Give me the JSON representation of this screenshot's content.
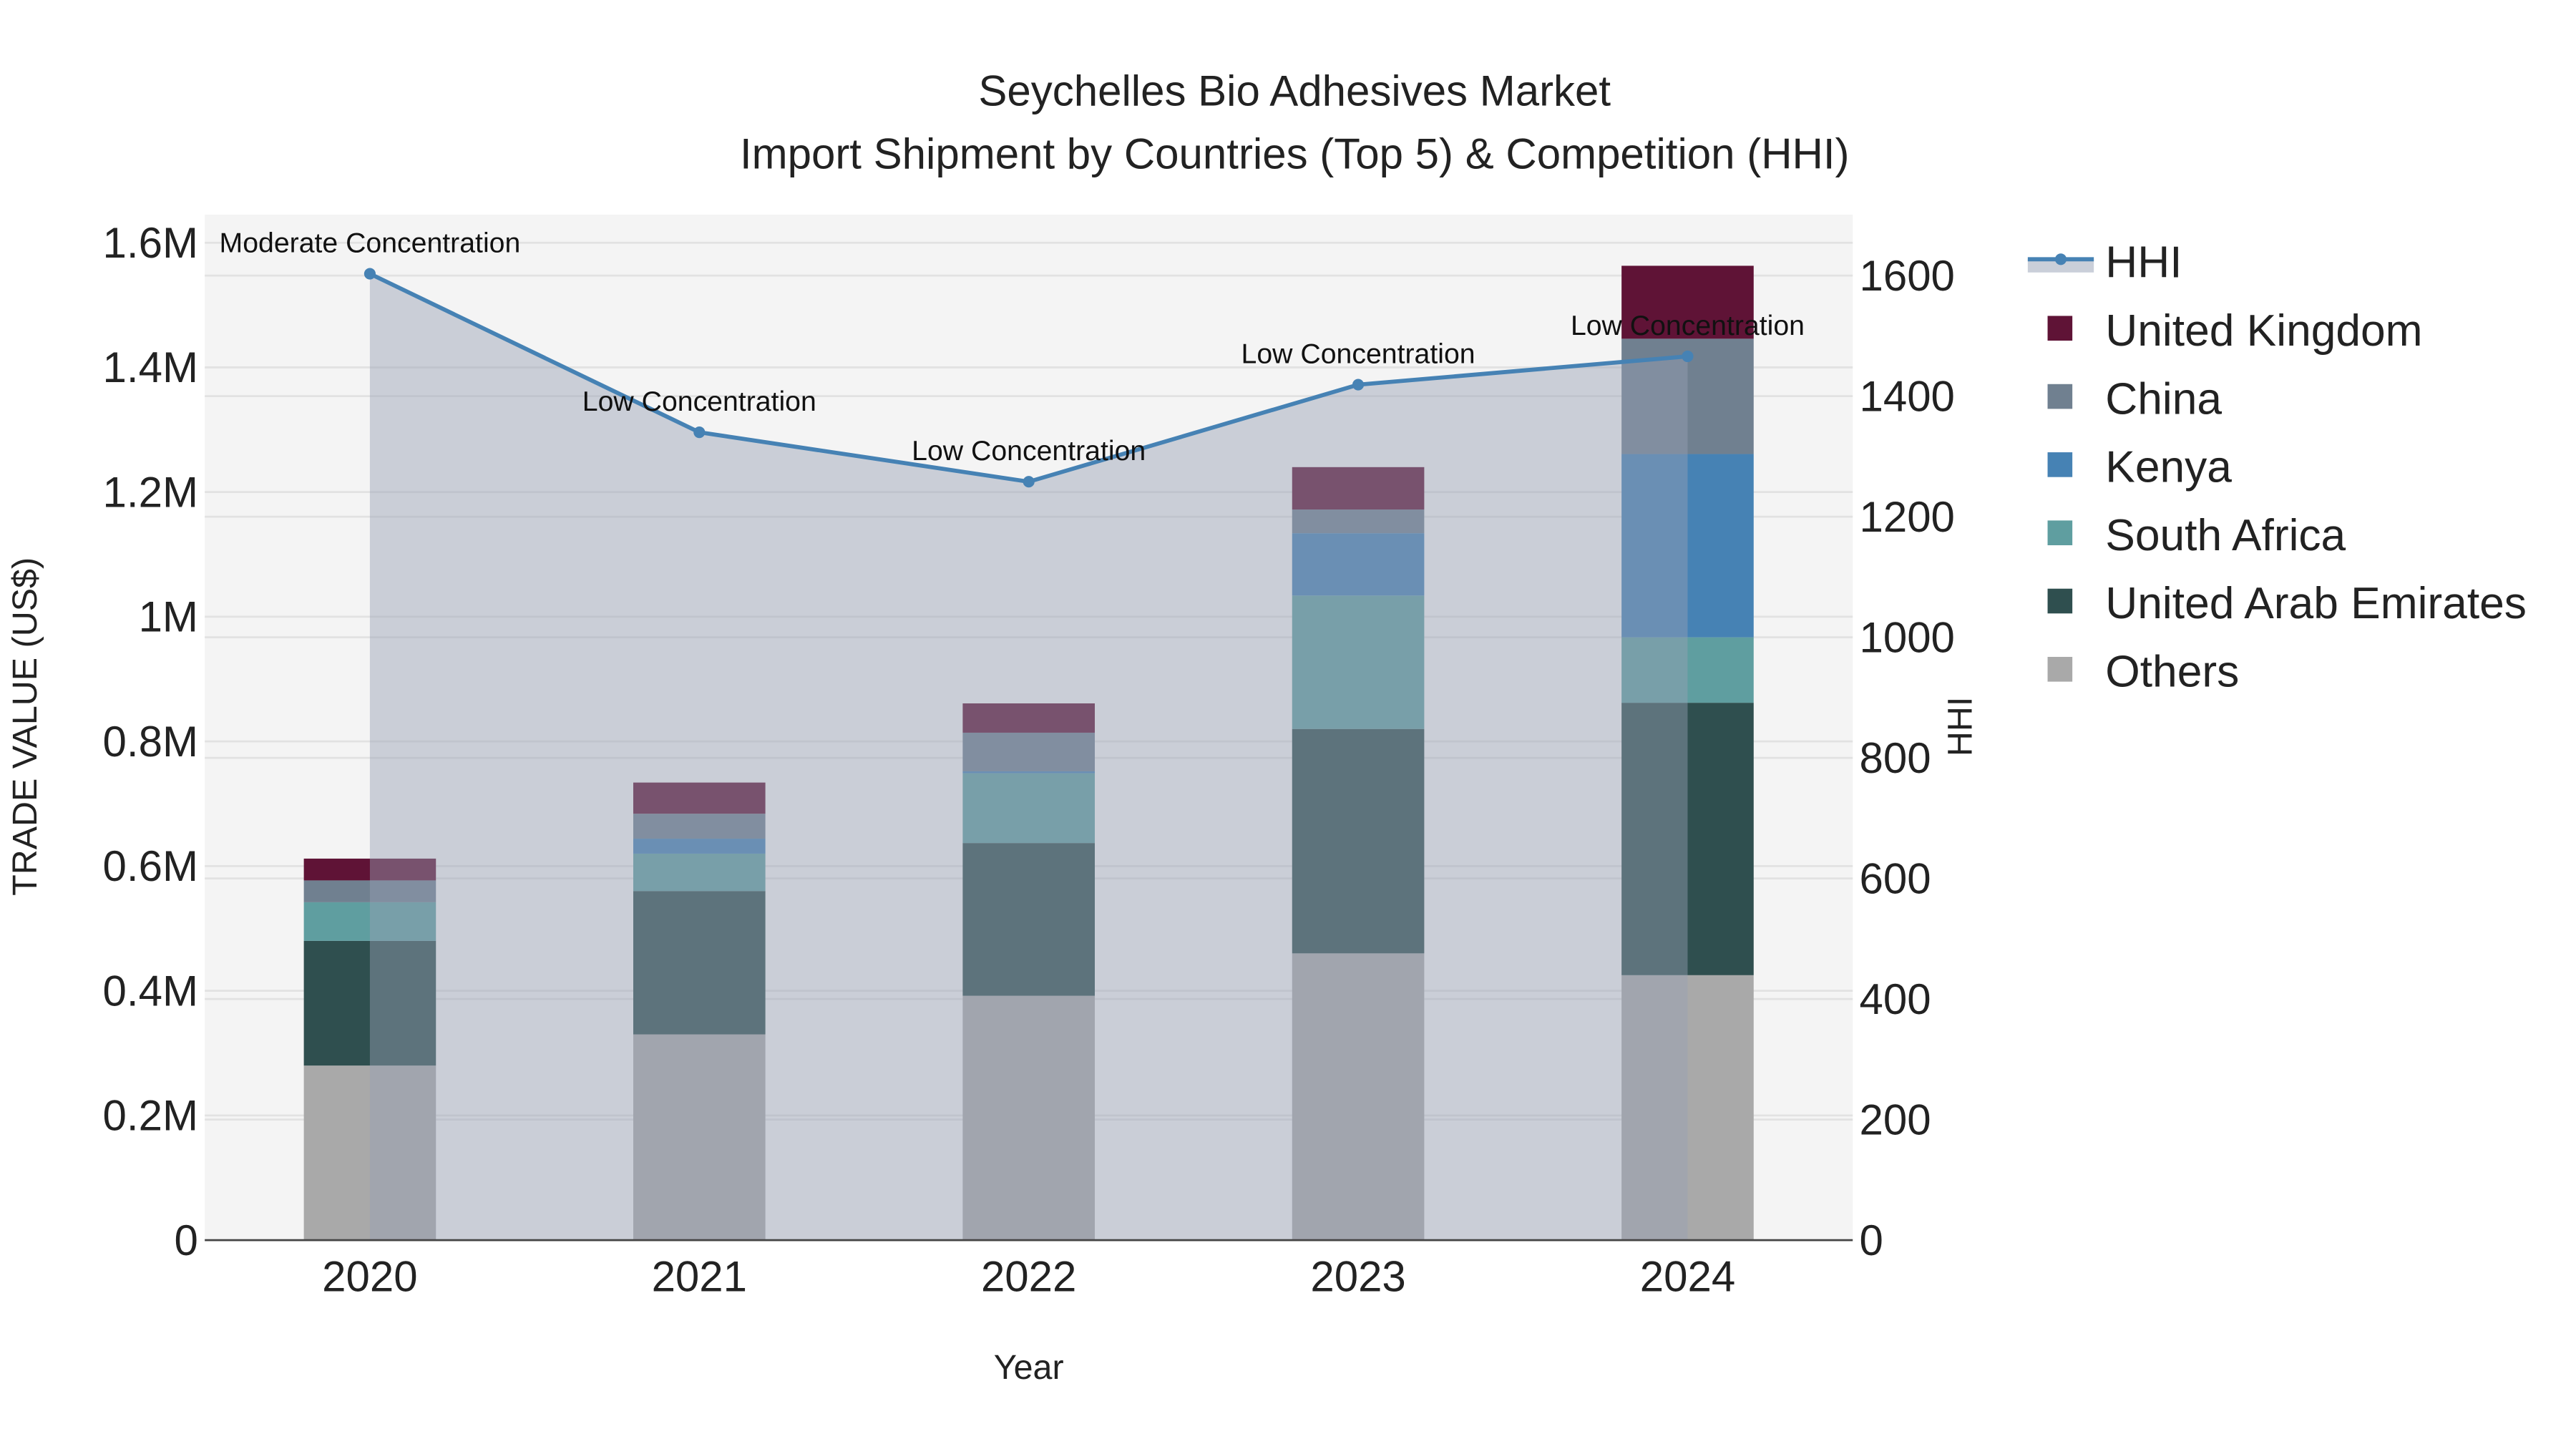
{
  "chart_data": {
    "type": "bar",
    "title": "Seychelles Bio Adhesives Market",
    "subtitle": "Import Shipment by Countries (Top 5) & Competition (HHI)",
    "xlabel": "Year",
    "ylabel": "TRADE VALUE (US$)",
    "y2label": "HHI",
    "categories": [
      "2020",
      "2021",
      "2022",
      "2023",
      "2024"
    ],
    "ylim": [
      0,
      1645000
    ],
    "y2lim": [
      0,
      1701
    ],
    "yticks": [
      {
        "v": 0,
        "label": "0"
      },
      {
        "v": 200000,
        "label": "0.2M"
      },
      {
        "v": 400000,
        "label": "0.4M"
      },
      {
        "v": 600000,
        "label": "0.6M"
      },
      {
        "v": 800000,
        "label": "0.8M"
      },
      {
        "v": 1000000,
        "label": "1M"
      },
      {
        "v": 1200000,
        "label": "1.2M"
      },
      {
        "v": 1400000,
        "label": "1.4M"
      },
      {
        "v": 1600000,
        "label": "1.6M"
      }
    ],
    "y2ticks": [
      {
        "v": 0,
        "label": "0"
      },
      {
        "v": 200,
        "label": "200"
      },
      {
        "v": 400,
        "label": "400"
      },
      {
        "v": 600,
        "label": "600"
      },
      {
        "v": 800,
        "label": "800"
      },
      {
        "v": 1000,
        "label": "1000"
      },
      {
        "v": 1200,
        "label": "1200"
      },
      {
        "v": 1400,
        "label": "1400"
      },
      {
        "v": 1600,
        "label": "1600"
      }
    ],
    "grid": true,
    "legend_position": "right",
    "series": [
      {
        "name": "Others",
        "color": "#a9a9a9",
        "values": [
          280000,
          330000,
          392000,
          460000,
          425000
        ]
      },
      {
        "name": "United Arab Emirates",
        "color": "#2f4f4f",
        "values": [
          200000,
          230000,
          245000,
          360000,
          437000
        ]
      },
      {
        "name": "South Africa",
        "color": "#5f9ea0",
        "values": [
          62000,
          60000,
          112000,
          214000,
          105000
        ]
      },
      {
        "name": "Kenya",
        "color": "#4682b4",
        "values": [
          0,
          24000,
          3000,
          100000,
          294000
        ]
      },
      {
        "name": "China",
        "color": "#708090",
        "values": [
          35000,
          40000,
          62000,
          38000,
          185000
        ]
      },
      {
        "name": "United Kingdom",
        "color": "#5f1336",
        "values": [
          35000,
          50000,
          47000,
          68000,
          117000
        ]
      }
    ],
    "hhi": {
      "name": "HHI",
      "color": "#4682b4",
      "values": [
        1603,
        1340,
        1258,
        1419,
        1466
      ],
      "annotations": [
        "Moderate Concentration",
        "Low Concentration",
        "Low Concentration",
        "Low Concentration",
        "Low Concentration"
      ]
    },
    "legend_order": [
      "HHI",
      "United Kingdom",
      "China",
      "Kenya",
      "South Africa",
      "United Arab Emirates",
      "Others"
    ]
  }
}
